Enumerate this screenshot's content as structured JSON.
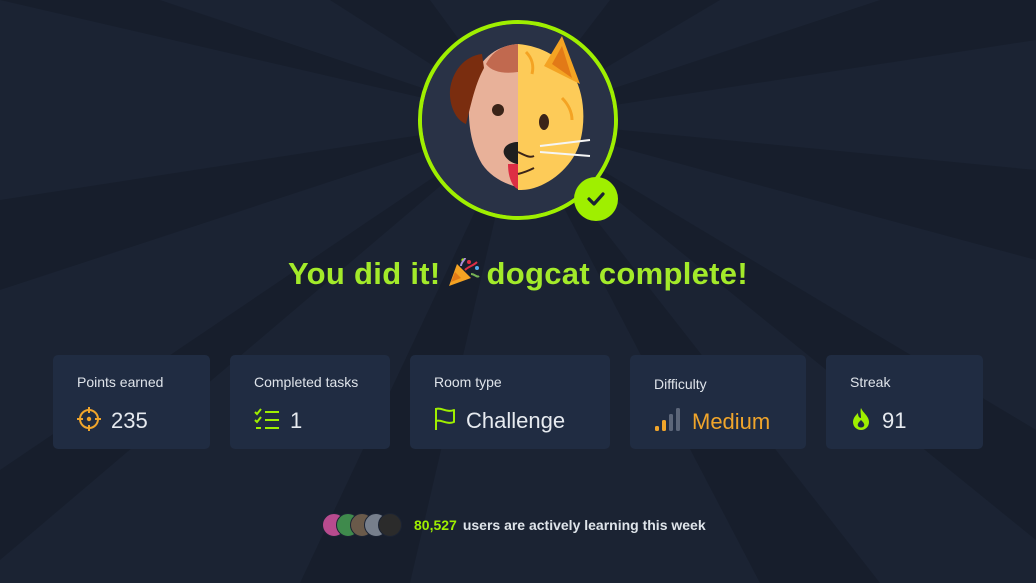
{
  "room": {
    "completion_title": "You did it!",
    "completion_subtitle": "dogcat complete!",
    "badge_icon": "dog-cat-avatar",
    "accent_color": "#9fef00"
  },
  "stats": [
    {
      "label": "Points earned",
      "value": "235",
      "icon": "crosshair-icon"
    },
    {
      "label": "Completed tasks",
      "value": "1",
      "icon": "checklist-icon"
    },
    {
      "label": "Room type",
      "value": "Challenge",
      "icon": "flag-icon"
    },
    {
      "label": "Difficulty",
      "value": "Medium",
      "icon": "signal-bars-icon",
      "color": "#f0a52b"
    },
    {
      "label": "Streak",
      "value": "91",
      "icon": "flame-icon"
    }
  ],
  "footer": {
    "active_users_count": "80,527",
    "active_users_text": "users are actively learning this week"
  }
}
